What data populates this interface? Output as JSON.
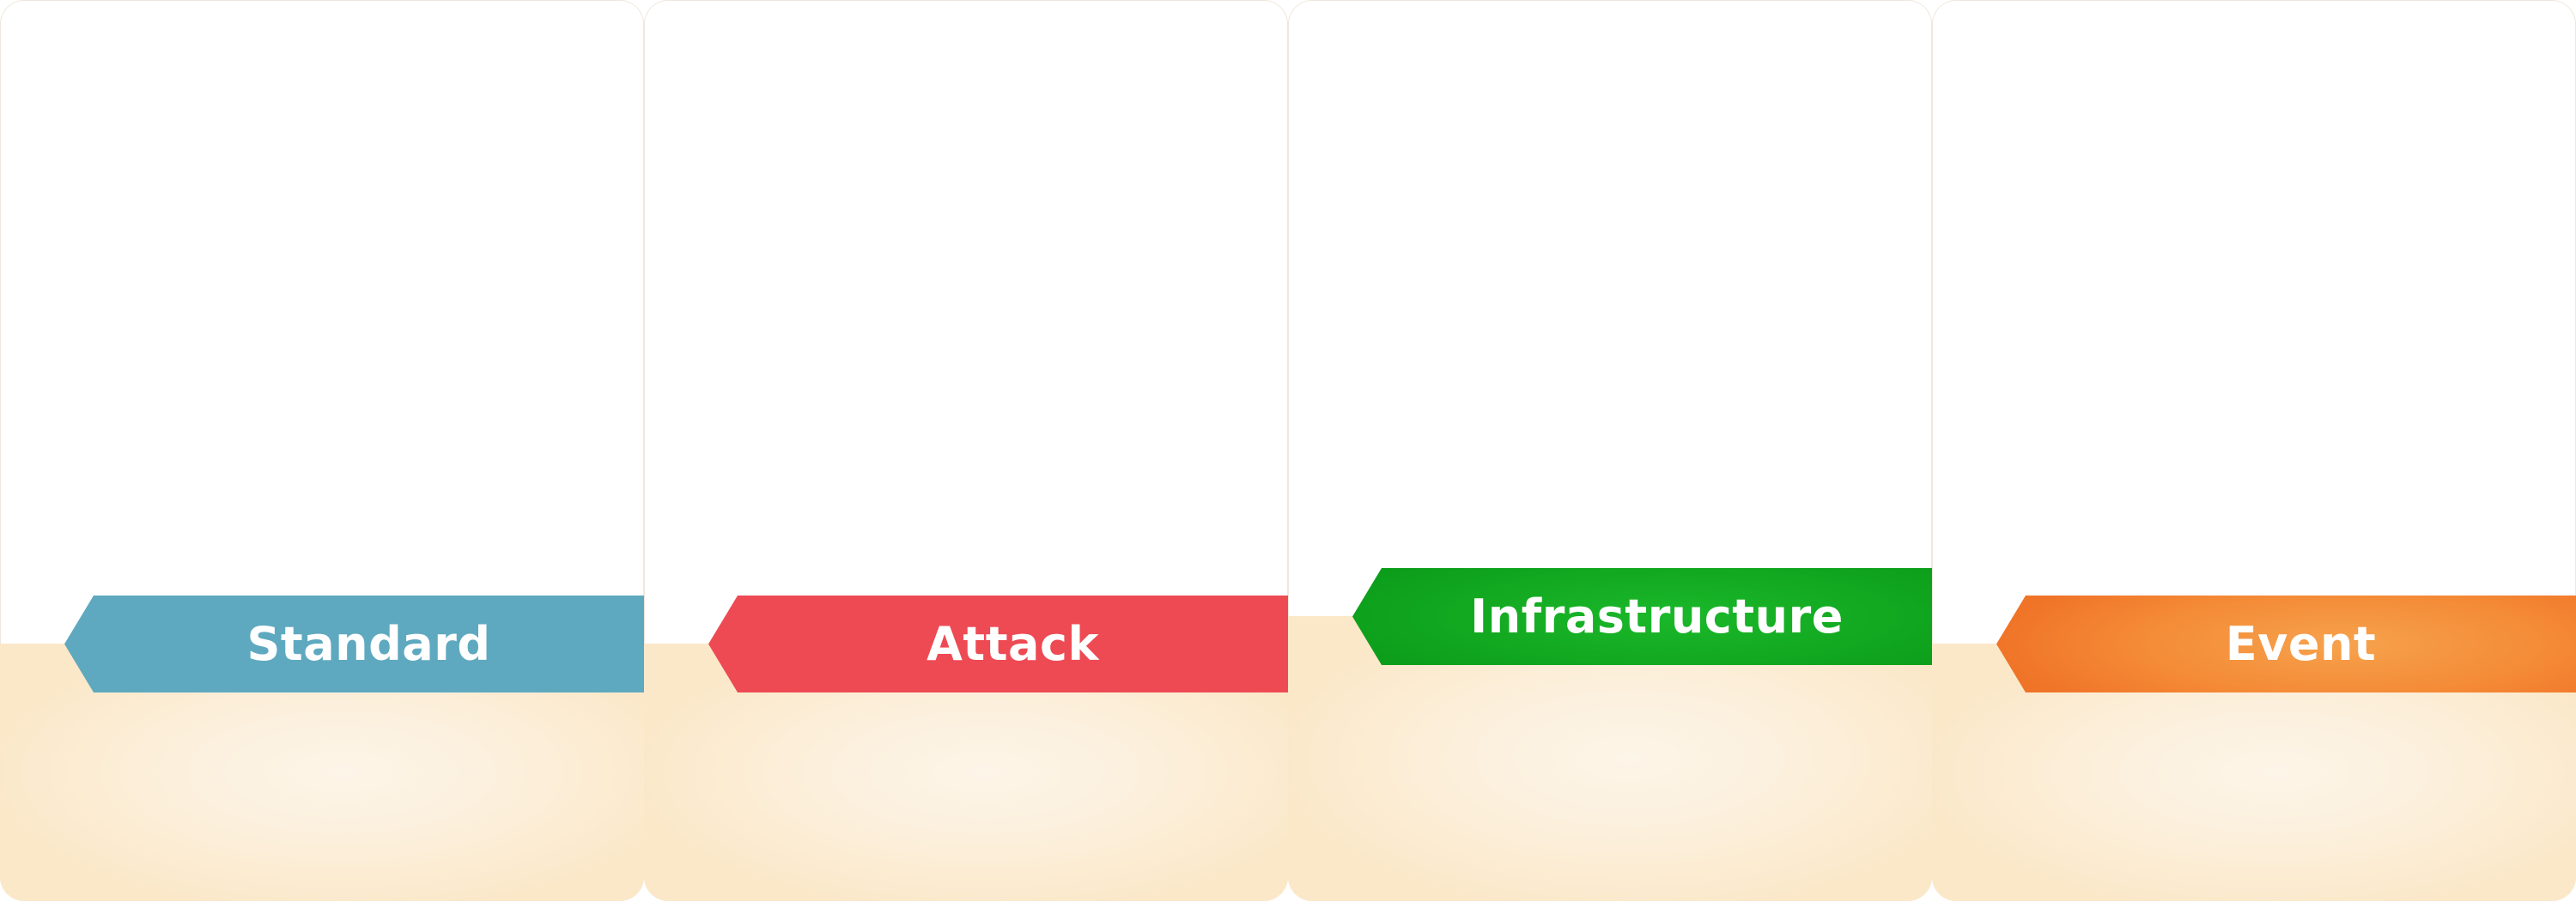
{
  "cards": [
    {
      "label": "Standard",
      "color": "#5ea9bf"
    },
    {
      "label": "Attack",
      "color": "#ee4a54"
    },
    {
      "label": "Infrastructure",
      "color": "#0a9a18"
    },
    {
      "label": "Event",
      "color": "#f48a36"
    }
  ]
}
